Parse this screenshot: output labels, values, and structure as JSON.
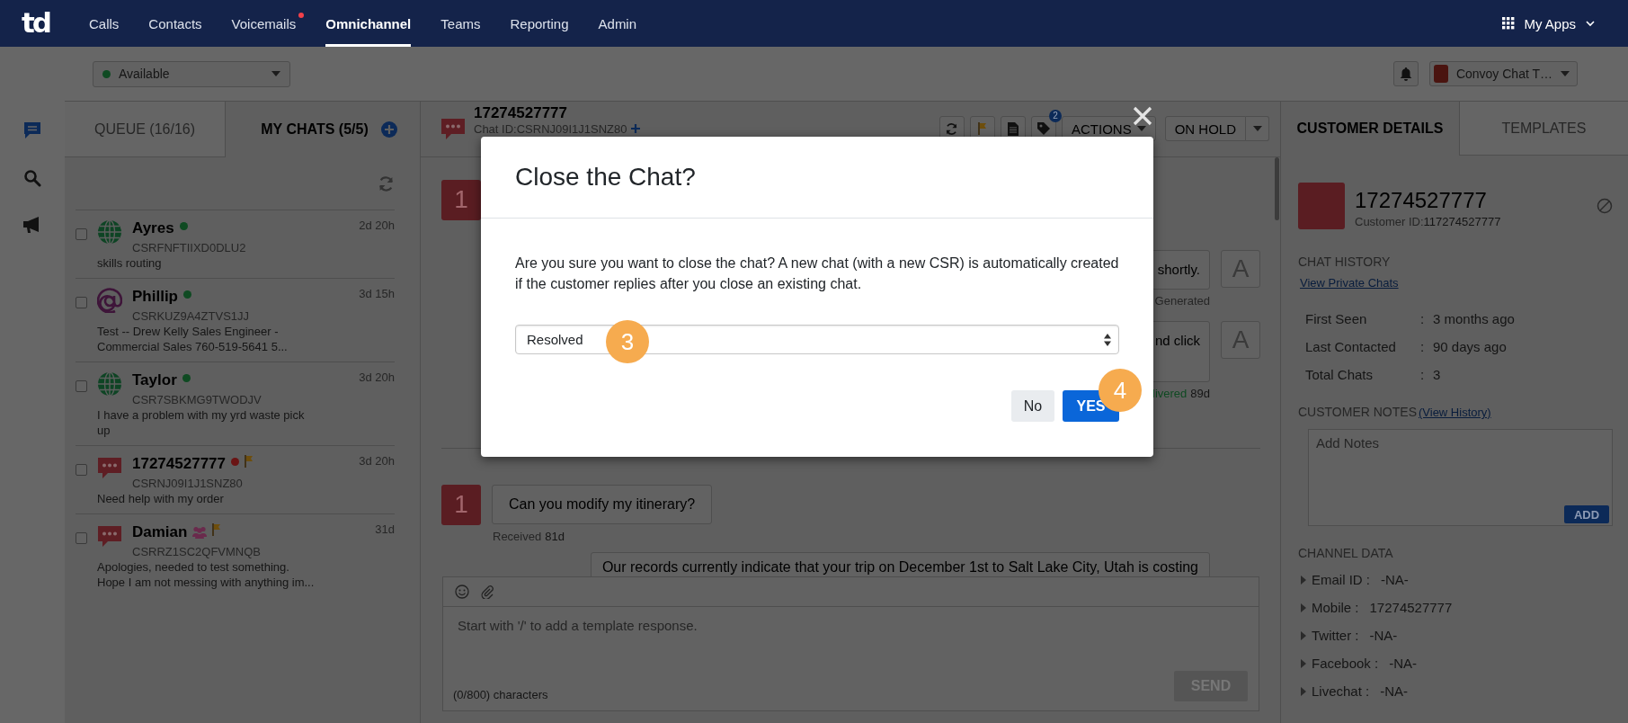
{
  "nav": {
    "logo": "td",
    "apps": "My Apps",
    "items": [
      {
        "label": "Calls",
        "selected": false,
        "alert": false
      },
      {
        "label": "Contacts",
        "selected": false,
        "alert": false
      },
      {
        "label": "Voicemails",
        "selected": false,
        "alert": true
      },
      {
        "label": "Omnichannel",
        "selected": true,
        "alert": false
      },
      {
        "label": "Teams",
        "selected": false,
        "alert": false
      },
      {
        "label": "Reporting",
        "selected": false,
        "alert": false
      },
      {
        "label": "Admin",
        "selected": false,
        "alert": false
      }
    ]
  },
  "status": {
    "label": "Available",
    "color": "#0f4a22"
  },
  "account": {
    "label": "Convoy Chat T…"
  },
  "rail": [
    {
      "kind": "chat",
      "selected": true
    },
    {
      "kind": "search",
      "selected": false
    },
    {
      "kind": "megaphone",
      "selected": false
    }
  ],
  "chat_tabs": [
    {
      "label": "QUEUE (16/16)",
      "selected": false
    },
    {
      "label": "MY CHATS (5/5)",
      "selected": true
    }
  ],
  "chats": [
    {
      "name": "Ayres",
      "csr": "CSRFNFTIIXD0DLU2",
      "preview": "skills routing",
      "time": "2d 20h",
      "kind": "web",
      "color": "#0f4a22",
      "flagged": false,
      "group": false,
      "checked": false
    },
    {
      "name": "Phillip",
      "csr": "CSRKUZ9A4ZTVS1JJ",
      "preview": "Test -- Drew Kelly Sales Engineer -\nCommercial Sales 760-519-5641 5...",
      "time": "3d 15h",
      "kind": "email",
      "color": "#0f4a22",
      "flagged": false,
      "group": false,
      "checked": false
    },
    {
      "name": "Taylor",
      "csr": "CSR7SBKMG9TWODJV",
      "preview": "I have a problem with my yrd waste pick\nup",
      "time": "3d 20h",
      "kind": "web",
      "color": "#0f4a22",
      "flagged": false,
      "group": false,
      "checked": false
    },
    {
      "name": "17274527777",
      "csr": "CSRNJ09I1J1SNZ80",
      "preview": "Need help with my order",
      "time": "3d 20h",
      "kind": "sms",
      "color": "#6a1414",
      "flagged": true,
      "group": false,
      "checked": false
    },
    {
      "name": "Damian",
      "csr": "CSRRZ1SC2QFVMNQB",
      "preview": "Apologies, needed to test something.\nHope I am not messing with anything im...",
      "time": "31d",
      "kind": "sms",
      "flagged": true,
      "group": true,
      "checked": false
    }
  ],
  "conversation": {
    "title": "17274527777",
    "chat_id": "Chat ID:CSRNJ09I1J1SNZ80",
    "tag_count": "2",
    "actions": "ACTIONS",
    "hold": "ON HOLD",
    "messages": [
      {
        "kind": "incoming",
        "avatar": "1"
      },
      {
        "kind": "outgoing",
        "text": "shortly.",
        "avatar": "A",
        "caption": {
          "text": "Generated",
          "kind": "info"
        }
      },
      {
        "kind": "outgoing",
        "text": "nd click",
        "avatar": "A",
        "caption": {
          "text": "livered",
          "kind": "delivered"
        },
        "time": "89d"
      },
      {
        "kind": "divider"
      },
      {
        "kind": "incoming",
        "avatar": "1",
        "text": "Can you modify my itinerary?",
        "caption": {
          "text": "Received",
          "kind": "info"
        },
        "time": "81d"
      },
      {
        "kind": "outgoing",
        "text": "Our records currently indicate that your trip on December 1st to Salt Lake City, Utah is costing"
      }
    ],
    "composer": {
      "placeholder": "Start with '/' to add a template response.",
      "counter": "(0/800) characters",
      "send": "SEND"
    }
  },
  "details": {
    "tabs": [
      {
        "label": "CUSTOMER DETAILS",
        "selected": true
      },
      {
        "label": "TEMPLATES",
        "selected": false
      }
    ],
    "name": "17274527777",
    "customer_id_label": "Customer ID:",
    "customer_id": "117274527777",
    "history_heading": "CHAT HISTORY",
    "private_link": "View Private Chats",
    "stats": [
      {
        "label": "First Seen",
        "sep": ":",
        "value": "3 months ago"
      },
      {
        "label": "Last Contacted",
        "sep": ":",
        "value": "90 days ago"
      },
      {
        "label": "Total Chats",
        "sep": ":",
        "value": "3"
      }
    ],
    "notes_heading": "CUSTOMER NOTES",
    "notes_link": "(View History)",
    "notes_placeholder": "Add Notes",
    "add": "ADD",
    "channel_heading": "CHANNEL DATA",
    "channels": [
      {
        "label": "Email ID :",
        "value": "-NA-"
      },
      {
        "label": "Mobile :",
        "value": "17274527777"
      },
      {
        "label": "Twitter :",
        "value": "-NA-"
      },
      {
        "label": "Facebook :",
        "value": "-NA-"
      },
      {
        "label": "Livechat :",
        "value": "-NA-"
      }
    ]
  },
  "modal": {
    "title": "Close the Chat?",
    "body": "Are you sure you want to close the chat? A new chat (with a new CSR) is automatically created if the customer replies after you close an existing chat.",
    "reason": "Resolved",
    "buttons": [
      {
        "label": "No",
        "kind": "secondary"
      },
      {
        "label": "YES",
        "kind": "primary"
      }
    ],
    "markers": [
      "3",
      "4"
    ]
  }
}
